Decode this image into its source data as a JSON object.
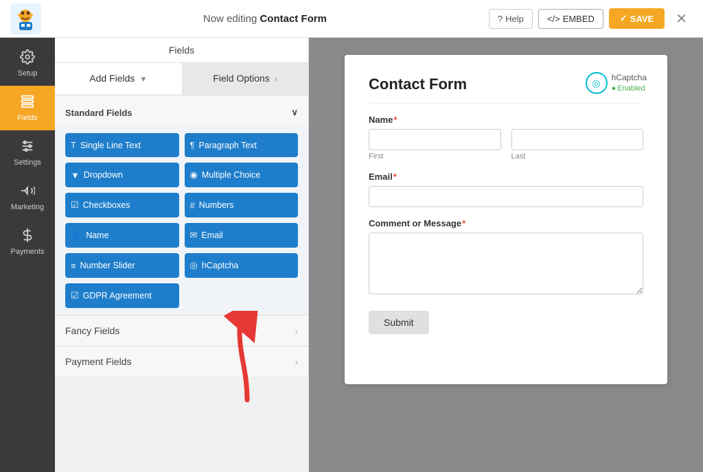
{
  "topbar": {
    "editing_prefix": "Now editing",
    "form_name": "Contact Form",
    "help_label": "Help",
    "embed_label": "EMBED",
    "save_label": "SAVE"
  },
  "center_header": {
    "fields_title": "Fields",
    "tab_add_fields": "Add Fields",
    "tab_field_options": "Field Options"
  },
  "standard_fields": {
    "section_label": "Standard Fields",
    "buttons": [
      {
        "label": "Single Line Text",
        "icon": "T"
      },
      {
        "label": "Paragraph Text",
        "icon": "¶"
      },
      {
        "label": "Dropdown",
        "icon": "▼"
      },
      {
        "label": "Multiple Choice",
        "icon": "◎"
      },
      {
        "label": "Checkboxes",
        "icon": "☑"
      },
      {
        "label": "Numbers",
        "icon": "#"
      },
      {
        "label": "Name",
        "icon": "👤"
      },
      {
        "label": "Email",
        "icon": "✉"
      },
      {
        "label": "Number Slider",
        "icon": "≡"
      },
      {
        "label": "hCaptcha",
        "icon": "◉"
      },
      {
        "label": "GDPR Agreement",
        "icon": "☑"
      }
    ]
  },
  "fancy_fields": {
    "section_label": "Fancy Fields"
  },
  "payment_fields": {
    "section_label": "Payment Fields"
  },
  "sidebar": {
    "items": [
      {
        "label": "Setup",
        "icon": "gear"
      },
      {
        "label": "Fields",
        "icon": "fields",
        "active": true
      },
      {
        "label": "Settings",
        "icon": "settings"
      },
      {
        "label": "Marketing",
        "icon": "marketing"
      },
      {
        "label": "Payments",
        "icon": "payments"
      }
    ]
  },
  "form_preview": {
    "title": "Contact Form",
    "hcaptcha_label": "hCaptcha",
    "hcaptcha_status": "Enabled",
    "name_label": "Name",
    "name_required": true,
    "first_label": "First",
    "last_label": "Last",
    "email_label": "Email",
    "email_required": true,
    "comment_label": "Comment or Message",
    "comment_required": true,
    "submit_label": "Submit"
  }
}
